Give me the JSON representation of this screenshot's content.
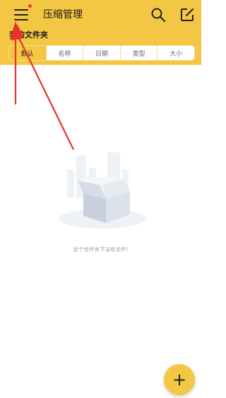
{
  "header": {
    "title": "压缩管理",
    "menu_icon": "menu-icon",
    "search_icon": "search-icon",
    "edit_icon": "edit-icon",
    "notification_dot_color": "#e83c3c"
  },
  "section": {
    "title": "我的文件夹"
  },
  "sort_tabs": [
    {
      "label": "默认"
    },
    {
      "label": "名称"
    },
    {
      "label": "日期"
    },
    {
      "label": "类型"
    },
    {
      "label": "大小"
    }
  ],
  "empty_state": {
    "icon": "empty-box-icon",
    "message": "这个文件夹下没有文件!"
  },
  "fab": {
    "label": "+",
    "icon": "plus-icon"
  },
  "colors": {
    "accent": "#f3c744",
    "annotation_arrow": "#e8342b"
  }
}
